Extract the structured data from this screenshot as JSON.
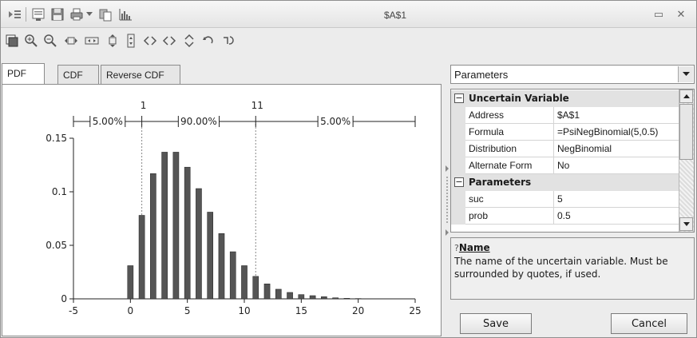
{
  "window": {
    "title": "$A$1",
    "minimize_glyph": "▭",
    "close_glyph": "✕"
  },
  "toolbar_top": {
    "icons": [
      "pin-icon",
      "report-icon",
      "save-icon",
      "print-icon",
      "dropdown-arrow-icon",
      "copy-icon",
      "chart-icon"
    ]
  },
  "toolbar_chart": {
    "icons": [
      "chart-options-icon",
      "zoom-in-icon",
      "zoom-out-icon",
      "fit-width-icon",
      "stretch-width-icon",
      "fit-height-icon",
      "stretch-height-icon",
      "move-left-icon",
      "move-right-icon",
      "move-up-icon",
      "move-down-icon",
      "reset-view-icon"
    ]
  },
  "tabs": [
    {
      "label": "PDF",
      "active": true
    },
    {
      "label": "CDF",
      "active": false
    },
    {
      "label": "Reverse CDF",
      "active": false
    }
  ],
  "chart_data": {
    "type": "bar",
    "distribution": "NegBinomial",
    "x": [
      0,
      1,
      2,
      3,
      4,
      5,
      6,
      7,
      8,
      9,
      10,
      11,
      12,
      13,
      14,
      15,
      16,
      17,
      18,
      19,
      20
    ],
    "values": [
      0.031,
      0.078,
      0.117,
      0.137,
      0.137,
      0.123,
      0.103,
      0.081,
      0.061,
      0.044,
      0.031,
      0.021,
      0.014,
      0.009,
      0.006,
      0.004,
      0.003,
      0.002,
      0.001,
      0.0005,
      0.0003
    ],
    "xlim": [
      -5,
      25
    ],
    "ylim": [
      0,
      0.15
    ],
    "xticks": [
      "-5",
      "0",
      "5",
      "10",
      "15",
      "20",
      "25"
    ],
    "xtick_values": [
      -5,
      0,
      5,
      10,
      15,
      20,
      25
    ],
    "yticks": [
      "0",
      "0.05",
      "0.1",
      "0.15"
    ],
    "ytick_values": [
      0,
      0.05,
      0.1,
      0.15
    ],
    "markers": [
      {
        "label": "1",
        "x": 1
      },
      {
        "label": "11",
        "x": 11
      }
    ],
    "bands": [
      "5.00%",
      "90.00%",
      "5.00%"
    ],
    "bar_color": "#555555",
    "bar_edge": "#222222",
    "marker_color": "#888888"
  },
  "right_panel": {
    "dropdown_value": "Parameters",
    "categories": [
      {
        "title": "Uncertain Variable",
        "toggle": "⊟",
        "rows": [
          {
            "name": "Address",
            "value": "$A$1"
          },
          {
            "name": "Formula",
            "value": "=PsiNegBinomial(5,0.5)"
          },
          {
            "name": "Distribution",
            "value": "NegBinomial"
          },
          {
            "name": "Alternate Form",
            "value": "No"
          }
        ]
      },
      {
        "title": "Parameters",
        "toggle": "⊟",
        "rows": [
          {
            "name": "suc",
            "value": "5"
          },
          {
            "name": "prob",
            "value": "0.5"
          }
        ]
      }
    ],
    "description": {
      "icon": "?",
      "title": "Name",
      "text": "The name of the uncertain variable. Must be surrounded by quotes, if used."
    },
    "save_label": "Save",
    "cancel_label": "Cancel"
  }
}
